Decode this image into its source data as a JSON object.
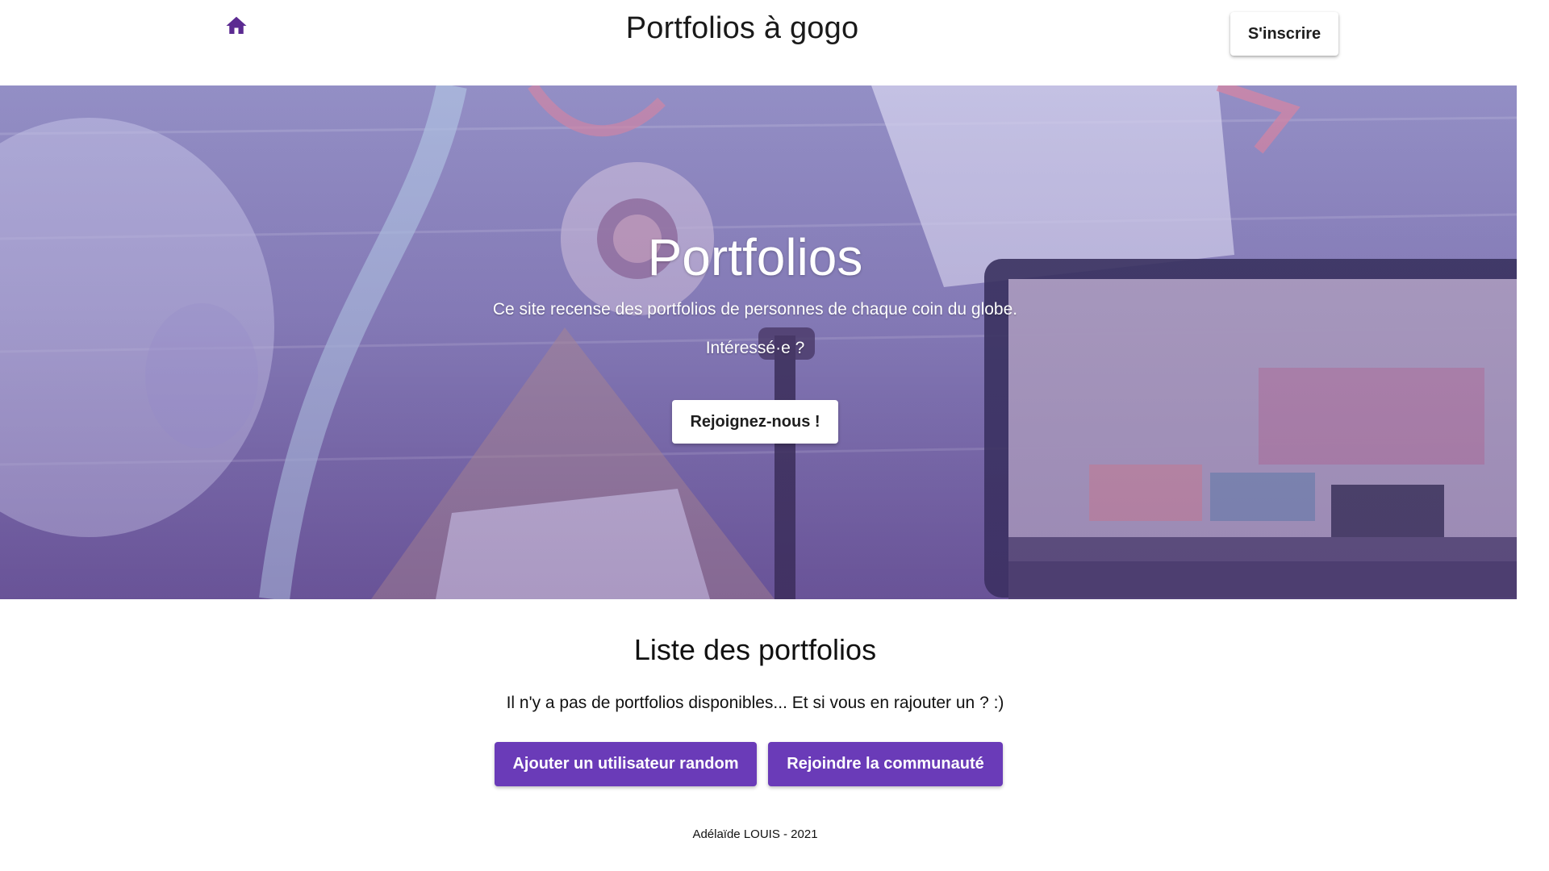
{
  "header": {
    "home_icon": "home-icon",
    "site_title": "Portfolios à gogo",
    "signup_label": "S'inscrire"
  },
  "hero": {
    "title": "Portfolios",
    "subtitle": "Ce site recense des portfolios de personnes de chaque coin du globe.",
    "question": "Intéressé·e ?",
    "join_label": "Rejoignez-nous !"
  },
  "portfolios": {
    "title": "Liste des portfolios",
    "empty_message": "Il n'y a pas de portfolios disponibles... Et si vous en rajouter un ? :)",
    "add_random_label": "Ajouter un utilisateur random",
    "join_community_label": "Rejoindre la communauté"
  },
  "footer": {
    "credit": "Adélaïde LOUIS - 2021"
  },
  "colors": {
    "accent": "#6a3bb8",
    "home_icon": "#5b2a91",
    "hero_tint": "#8d86bb"
  }
}
